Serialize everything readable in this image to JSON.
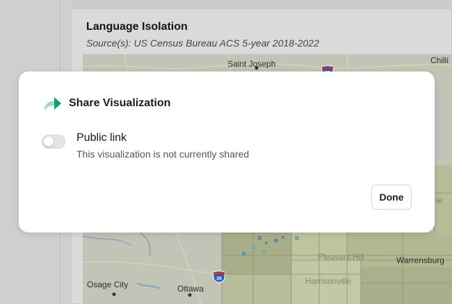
{
  "background": {
    "visualization_title": "Language Isolation",
    "source": "Source(s): US Census Bureau ACS 5-year 2018-2022",
    "map_labels": {
      "saint_joseph": "Saint Joseph",
      "chillicothe": "Chilli",
      "warrensburg": "Warrensburg",
      "osage_city": "Osage City",
      "ottawa": "Ottawa",
      "pleasant_hill": "Pleasant Hill",
      "harrisonville": "Harrisonville",
      "lexington_fragment": "le"
    },
    "highway_shields": {
      "i29": "29",
      "i35": "35"
    }
  },
  "modal": {
    "title": "Share Visualization",
    "public_link_label": "Public link",
    "share_status": "This visualization is not currently shared",
    "toggle_on": false,
    "done_label": "Done"
  },
  "colors": {
    "accent": "#1a9b6c",
    "accent_light": "#9bdcc2"
  }
}
